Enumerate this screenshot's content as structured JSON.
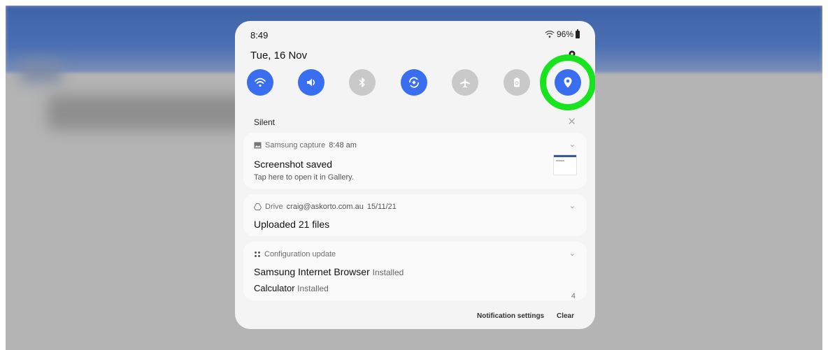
{
  "status_bar": {
    "time": "8:49",
    "battery": "96%"
  },
  "date": "Tue, 16 Nov",
  "quick_settings": [
    {
      "name": "wifi",
      "icon": "wifi-icon",
      "state": "on"
    },
    {
      "name": "sound",
      "icon": "volume-icon",
      "state": "on"
    },
    {
      "name": "bluetooth",
      "icon": "bluetooth-icon",
      "state": "off"
    },
    {
      "name": "auto-rotate",
      "icon": "rotate-icon",
      "state": "on"
    },
    {
      "name": "airplane-mode",
      "icon": "airplane-icon",
      "state": "off"
    },
    {
      "name": "power-saving",
      "icon": "battery-recycle-icon",
      "state": "off"
    },
    {
      "name": "location",
      "icon": "location-pin-icon",
      "state": "on"
    }
  ],
  "highlight_color": "#17e41d",
  "accent_color": "#3a6ef0",
  "section_label": "Silent",
  "notifications": [
    {
      "app": "Samsung capture",
      "time": "8:48 am",
      "title": "Screenshot saved",
      "text": "Tap here to open it in Gallery."
    },
    {
      "app": "Drive",
      "account": "craig@askorto.com.au",
      "time": "15/11/21",
      "title": "Uploaded 21 files"
    },
    {
      "app": "Configuration update",
      "line1_app": "Samsung Internet Browser",
      "line1_status": "Installed",
      "line2_app": "Calculator",
      "line2_status": "Installed",
      "count": "4"
    }
  ],
  "footer": {
    "settings_label": "Notification settings",
    "clear_label": "Clear"
  }
}
